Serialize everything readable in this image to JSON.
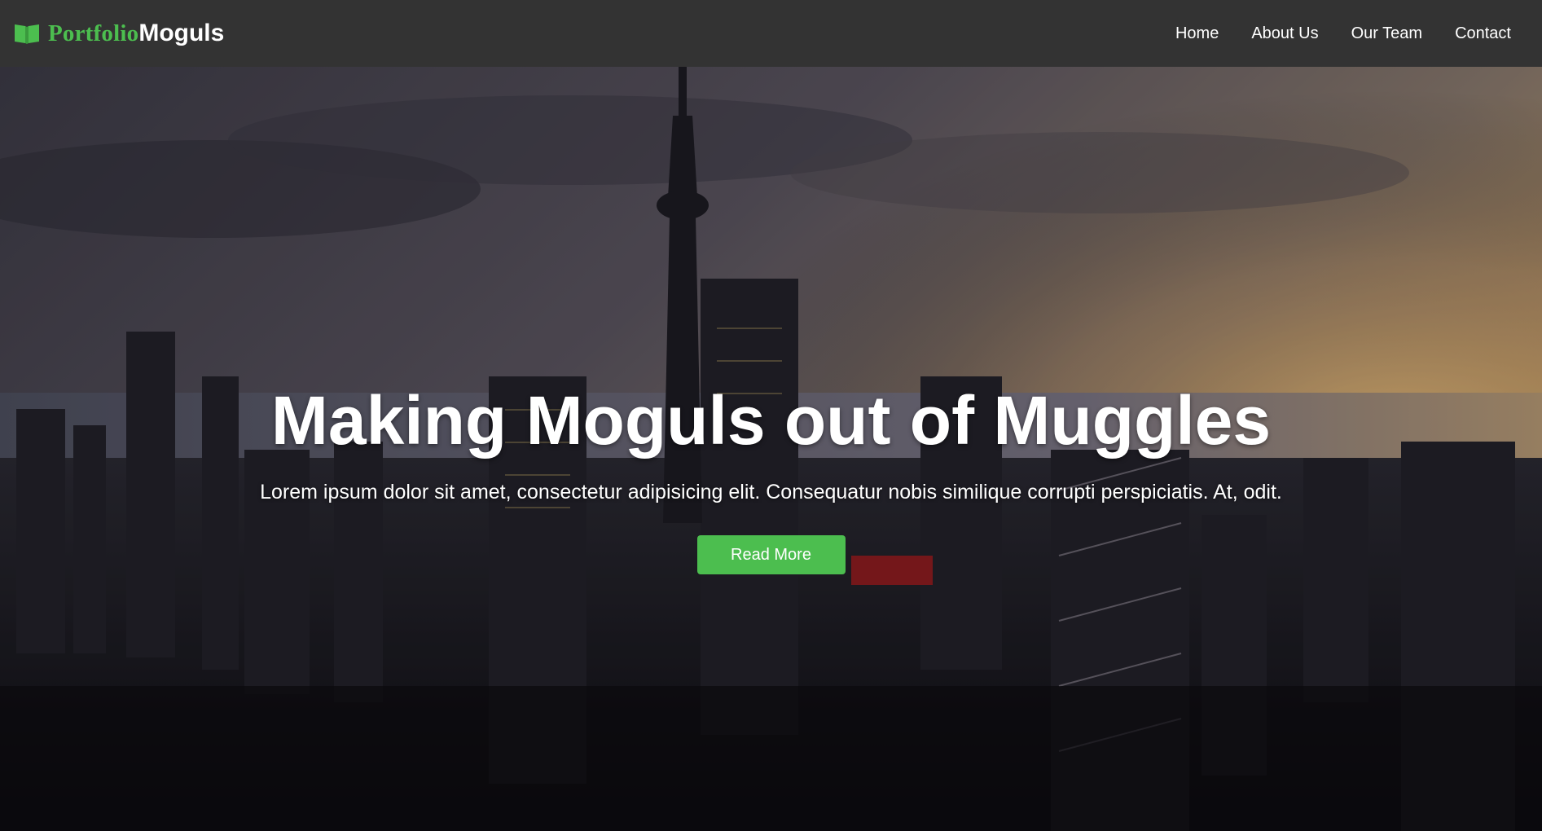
{
  "brand": {
    "name_first": "Portfolio",
    "name_second": "Moguls",
    "icon": "book-open-icon",
    "accent_color": "#4cbe4f"
  },
  "nav": {
    "items": [
      {
        "label": "Home"
      },
      {
        "label": "About Us"
      },
      {
        "label": "Our Team"
      },
      {
        "label": "Contact"
      }
    ]
  },
  "hero": {
    "title": "Making Moguls out of Muggles",
    "text": "Lorem ipsum dolor sit amet, consectetur adipisicing elit. Consequatur nobis similique corrupti perspiciatis. At, odit.",
    "button_label": "Read More",
    "button_color": "#4cbe4f",
    "background": "city-skyline-sunset-photo"
  },
  "colors": {
    "navbar": "#333333",
    "text": "#ffffff"
  }
}
